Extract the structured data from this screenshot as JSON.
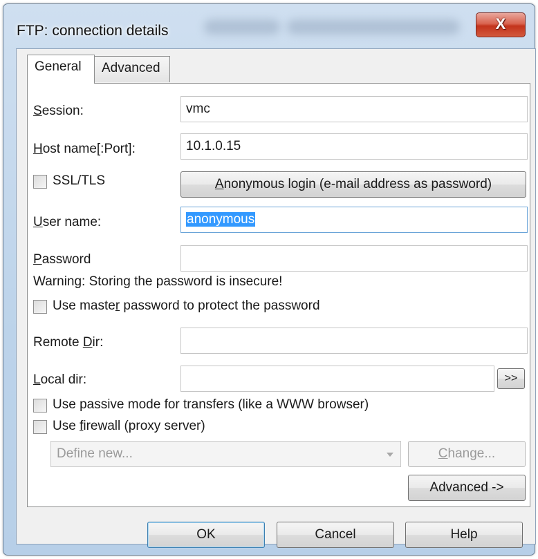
{
  "window": {
    "title": "FTP: connection details",
    "close_label": "X"
  },
  "tabs": [
    {
      "label": "General",
      "selected": true
    },
    {
      "label": "Advanced",
      "selected": false
    }
  ],
  "general": {
    "session_label": "Session:",
    "session_value": "vmc",
    "host_label": "Host name[:Port]:",
    "host_value": "10.1.0.15",
    "ssl_label": "SSL/TLS",
    "ssl_checked": false,
    "anonymous_button": "Anonymous login (e-mail address as password)",
    "user_label": "User name:",
    "user_value": "anonymous",
    "password_label": "Password",
    "password_value": "",
    "warning_text": "Warning: Storing the password is insecure!",
    "master_password_label": "Use master password to protect the password",
    "remote_dir_label": "Remote Dir:",
    "remote_dir_value": "",
    "local_dir_label": "Local dir:",
    "local_dir_value": "",
    "browse_button": ">>",
    "passive_label": "Use passive mode for transfers (like a WWW browser)",
    "firewall_label": "Use firewall (proxy server)",
    "proxy_select_value": "Define new...",
    "change_button": "Change...",
    "advanced_button": "Advanced ->"
  },
  "footer": {
    "ok": "OK",
    "cancel": "Cancel",
    "help": "Help"
  },
  "colors": {
    "selection": "#3399ff",
    "focus_border": "#6aa4d8",
    "close_button": "#c3331c"
  }
}
